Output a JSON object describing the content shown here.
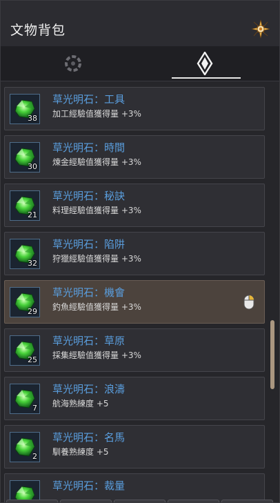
{
  "window": {
    "title": "文物背包"
  },
  "tabs": [
    {
      "name": "ring",
      "icon": "ring-icon",
      "active": false
    },
    {
      "name": "diamond",
      "icon": "diamond-icon",
      "active": true
    }
  ],
  "items": [
    {
      "name": "草光明石：工具",
      "effect": "加工經驗值獲得量 +3%",
      "count": "38",
      "icon": "green-gem-icon"
    },
    {
      "name": "草光明石：時間",
      "effect": "煉金經驗值獲得量 +3%",
      "count": "30",
      "icon": "green-gem-icon"
    },
    {
      "name": "草光明石：秘訣",
      "effect": "料理經驗值獲得量 +3%",
      "count": "21",
      "icon": "green-gem-icon"
    },
    {
      "name": "草光明石：陷阱",
      "effect": "狩獵經驗值獲得量 +3%",
      "count": "32",
      "icon": "green-gem-icon"
    },
    {
      "name": "草光明石：機會",
      "effect": "釣魚經驗值獲得量 +3%",
      "count": "29",
      "icon": "green-gem-icon",
      "selected": true
    },
    {
      "name": "草光明石：草原",
      "effect": "採集經驗值獲得量 +3%",
      "count": "25",
      "icon": "green-gem-icon"
    },
    {
      "name": "草光明石：浪濤",
      "effect": "航海熟練度 +5",
      "count": "7",
      "icon": "green-gem-icon"
    },
    {
      "name": "草光明石：名馬",
      "effect": "馴養熟練度 +5",
      "count": "2",
      "icon": "green-gem-icon"
    },
    {
      "name": "草光明石：裁量",
      "effect": "",
      "count": "",
      "icon": "green-gem-icon"
    }
  ],
  "colors": {
    "item_name": "#5a9ede",
    "selected_item_bg": "#4c433d",
    "scroll_thumb": "#a99680"
  }
}
